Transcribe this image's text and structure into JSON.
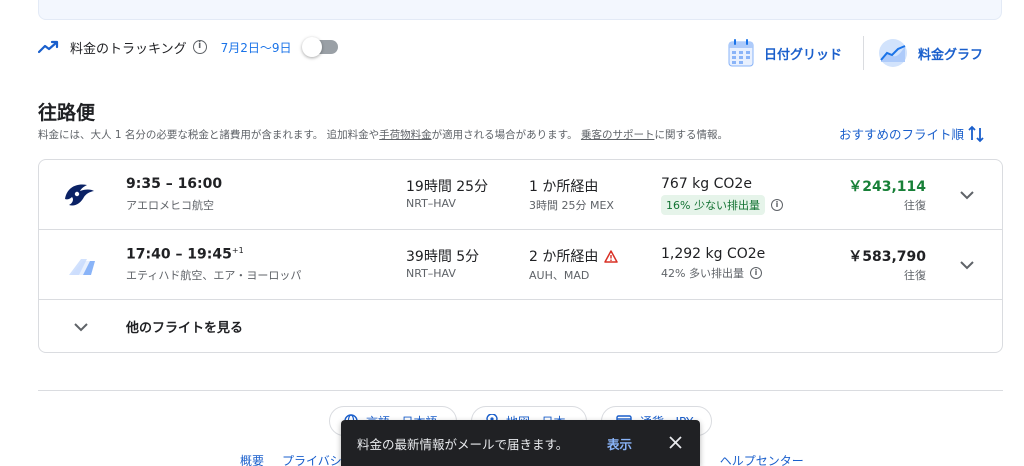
{
  "tracking": {
    "label": "料金のトラッキング",
    "info_glyph": "i",
    "dates": "7月2日〜9日",
    "enabled": false
  },
  "views": {
    "date_grid": "日付グリッド",
    "price_graph": "料金グラフ"
  },
  "section": {
    "title": "往路便",
    "sub_part1": "料金には、大人 1 名分の必要な税金と諸費用が含まれます。 追加料金や",
    "sub_link1": "手荷物料金",
    "sub_part2": "が適用される場合があります。",
    "sub_link2": "乗客のサポート",
    "sub_part3": "に関する情報。",
    "sort_label": "おすすめのフライト順"
  },
  "flights": [
    {
      "times": "9:35 – 16:00",
      "day_offset": "",
      "airline": "アエロメヒコ航空",
      "duration": "19時間 25分",
      "route": "NRT–HAV",
      "stops": "1 か所経由",
      "stops_detail": "3時間 25分 MEX",
      "co2": "767 kg CO2e",
      "emission_note": "16% 少ない排出量",
      "price": "￥243,114",
      "trip_type": "往復",
      "price_color": "#188038"
    },
    {
      "times": "17:40 – 19:45",
      "day_offset": "+1",
      "airline": "エティハド航空、エア・ヨーロッパ",
      "duration": "39時間 5分",
      "route": "NRT–HAV",
      "stops": "2 か所経由",
      "stops_detail": "AUH、MAD",
      "co2": "1,292 kg CO2e",
      "emission_note": "42% 多い排出量",
      "price": "￥583,790",
      "trip_type": "往復",
      "price_color": "#202124"
    }
  ],
  "more_flights": "他のフライトを見る",
  "footer": {
    "language_chip": "言語 · 日本語",
    "region_chip": "地図 · 日本",
    "currency_chip": "通貨 · JPY",
    "links": [
      "概要",
      "プライバシー",
      "ヘルプセンター"
    ]
  },
  "snackbar": {
    "message": "料金の最新情報がメールで届きます。",
    "action": "表示"
  },
  "colors": {
    "accent": "#1a73e8",
    "price_green": "#188038",
    "badge_green_bg": "#e6f4ea",
    "warning_red": "#d93025"
  }
}
